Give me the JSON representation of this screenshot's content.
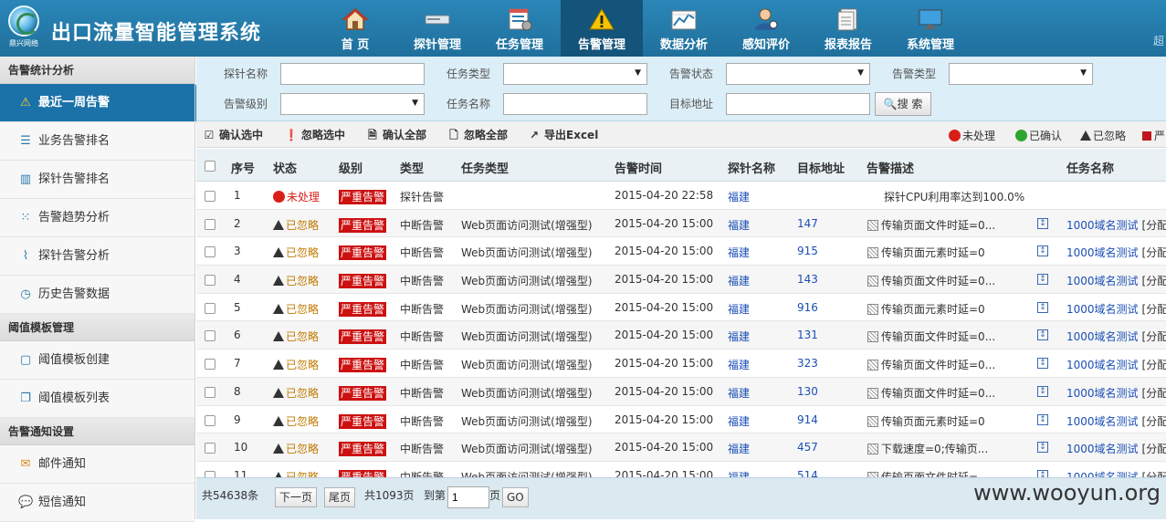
{
  "header": {
    "logo_text": "鼎兴网络",
    "title": "出口流量智能管理系统",
    "more_text": "超",
    "nav": [
      {
        "label": "首 页",
        "icon": "home-icon"
      },
      {
        "label": "探针管理",
        "icon": "probe-icon"
      },
      {
        "label": "任务管理",
        "icon": "task-icon"
      },
      {
        "label": "告警管理",
        "icon": "alarm-icon"
      },
      {
        "label": "数据分析",
        "icon": "chart-icon"
      },
      {
        "label": "感知评价",
        "icon": "user-icon"
      },
      {
        "label": "报表报告",
        "icon": "report-icon"
      },
      {
        "label": "系统管理",
        "icon": "monitor-icon"
      }
    ]
  },
  "sidebar": {
    "sections": [
      {
        "title": "告警统计分析",
        "items": [
          {
            "label": "最近一周告警",
            "icon": "warning-icon"
          },
          {
            "label": "业务告警排名",
            "icon": "rank-icon"
          },
          {
            "label": "探针告警排名",
            "icon": "bar-chart-icon"
          },
          {
            "label": "告警趋势分析",
            "icon": "trend-icon"
          },
          {
            "label": "探针告警分析",
            "icon": "line-chart-icon"
          },
          {
            "label": "历史告警数据",
            "icon": "history-icon"
          }
        ]
      },
      {
        "title": "阈值模板管理",
        "items": [
          {
            "label": "阈值模板创建",
            "icon": "template-add-icon"
          },
          {
            "label": "阈值模板列表",
            "icon": "template-list-icon"
          }
        ]
      },
      {
        "title": "告警通知设置",
        "items": [
          {
            "label": "邮件通知",
            "icon": "mail-icon"
          },
          {
            "label": "短信通知",
            "icon": "sms-icon"
          }
        ]
      }
    ]
  },
  "filters": {
    "probe_name_label": "探针名称",
    "task_type_label": "任务类型",
    "alarm_status_label": "告警状态",
    "alarm_type_label": "告警类型",
    "alarm_level_label": "告警级别",
    "task_name_label": "任务名称",
    "target_address_label": "目标地址",
    "search_button": "搜 索"
  },
  "toolbar": {
    "confirm_selected": "确认选中",
    "ignore_selected": "忽略选中",
    "confirm_all": "确认全部",
    "ignore_all": "忽略全部",
    "export_excel": "导出Excel",
    "legend_unhandled": "未处理",
    "legend_confirmed": "已确认",
    "legend_ignored": "已忽略",
    "legend_severe": "严"
  },
  "table": {
    "headers": {
      "index": "序号",
      "status": "状态",
      "level": "级别",
      "type": "类型",
      "task_type": "任务类型",
      "time": "告警时间",
      "probe": "探针名称",
      "target": "目标地址",
      "desc": "告警描述",
      "task_name": "任务名称"
    },
    "rows": [
      {
        "index": "1",
        "status": "未处理",
        "level": "严重告警",
        "type": "探针告警",
        "task_type": "",
        "time": "2015-04-20 22:58",
        "probe": "福建",
        "target": "",
        "desc": "探针CPU利用率达到100.0%",
        "task_name": "",
        "task_extra": ""
      },
      {
        "index": "2",
        "status": "已忽略",
        "level": "严重告警",
        "type": "中断告警",
        "task_type": "Web页面访问测试(增强型)",
        "time": "2015-04-20 15:00",
        "probe": "福建",
        "target": "147",
        "desc": "传输页面文件时延=0...",
        "task_name": "1000域名测试",
        "task_extra": "[分配"
      },
      {
        "index": "3",
        "status": "已忽略",
        "level": "严重告警",
        "type": "中断告警",
        "task_type": "Web页面访问测试(增强型)",
        "time": "2015-04-20 15:00",
        "probe": "福建",
        "target": "915",
        "desc": "传输页面元素时延=0",
        "task_name": "1000域名测试",
        "task_extra": "[分配"
      },
      {
        "index": "4",
        "status": "已忽略",
        "level": "严重告警",
        "type": "中断告警",
        "task_type": "Web页面访问测试(增强型)",
        "time": "2015-04-20 15:00",
        "probe": "福建",
        "target": "143",
        "desc": "传输页面文件时延=0...",
        "task_name": "1000域名测试",
        "task_extra": "[分配"
      },
      {
        "index": "5",
        "status": "已忽略",
        "level": "严重告警",
        "type": "中断告警",
        "task_type": "Web页面访问测试(增强型)",
        "time": "2015-04-20 15:00",
        "probe": "福建",
        "target": "916",
        "desc": "传输页面元素时延=0",
        "task_name": "1000域名测试",
        "task_extra": "[分配"
      },
      {
        "index": "6",
        "status": "已忽略",
        "level": "严重告警",
        "type": "中断告警",
        "task_type": "Web页面访问测试(增强型)",
        "time": "2015-04-20 15:00",
        "probe": "福建",
        "target": "131",
        "desc": "传输页面文件时延=0...",
        "task_name": "1000域名测试",
        "task_extra": "[分配"
      },
      {
        "index": "7",
        "status": "已忽略",
        "level": "严重告警",
        "type": "中断告警",
        "task_type": "Web页面访问测试(增强型)",
        "time": "2015-04-20 15:00",
        "probe": "福建",
        "target": "323",
        "desc": "传输页面文件时延=0...",
        "task_name": "1000域名测试",
        "task_extra": "[分配"
      },
      {
        "index": "8",
        "status": "已忽略",
        "level": "严重告警",
        "type": "中断告警",
        "task_type": "Web页面访问测试(增强型)",
        "time": "2015-04-20 15:00",
        "probe": "福建",
        "target": "130",
        "desc": "传输页面文件时延=0...",
        "task_name": "1000域名测试",
        "task_extra": "[分配"
      },
      {
        "index": "9",
        "status": "已忽略",
        "level": "严重告警",
        "type": "中断告警",
        "task_type": "Web页面访问测试(增强型)",
        "time": "2015-04-20 15:00",
        "probe": "福建",
        "target": "914",
        "desc": "传输页面元素时延=0",
        "task_name": "1000域名测试",
        "task_extra": "[分配"
      },
      {
        "index": "10",
        "status": "已忽略",
        "level": "严重告警",
        "type": "中断告警",
        "task_type": "Web页面访问测试(增强型)",
        "time": "2015-04-20 15:00",
        "probe": "福建",
        "target": "457",
        "desc": "下载速度=0;传输页...",
        "task_name": "1000域名测试",
        "task_extra": "[分配"
      },
      {
        "index": "11",
        "status": "已忽略",
        "level": "严重告警",
        "type": "中断告警",
        "task_type": "Web页面访问测试(增强型)",
        "time": "2015-04-20 15:00",
        "probe": "福建",
        "target": "514",
        "desc": "传输页面文件时延=...",
        "task_name": "1000域名测试",
        "task_extra": "[分配"
      }
    ]
  },
  "pager": {
    "total": "共54638条",
    "next": "下一页",
    "last": "尾页",
    "pages": "共1093页",
    "goto_label": "到第",
    "page_value": "1",
    "page_suffix": "页",
    "go": "GO"
  },
  "watermark": "www.wooyun.org",
  "colors": {
    "header_bg": "#1f6f9c",
    "active_nav": "#14537a",
    "severe": "#cc1010",
    "link": "#1a4fb5"
  }
}
